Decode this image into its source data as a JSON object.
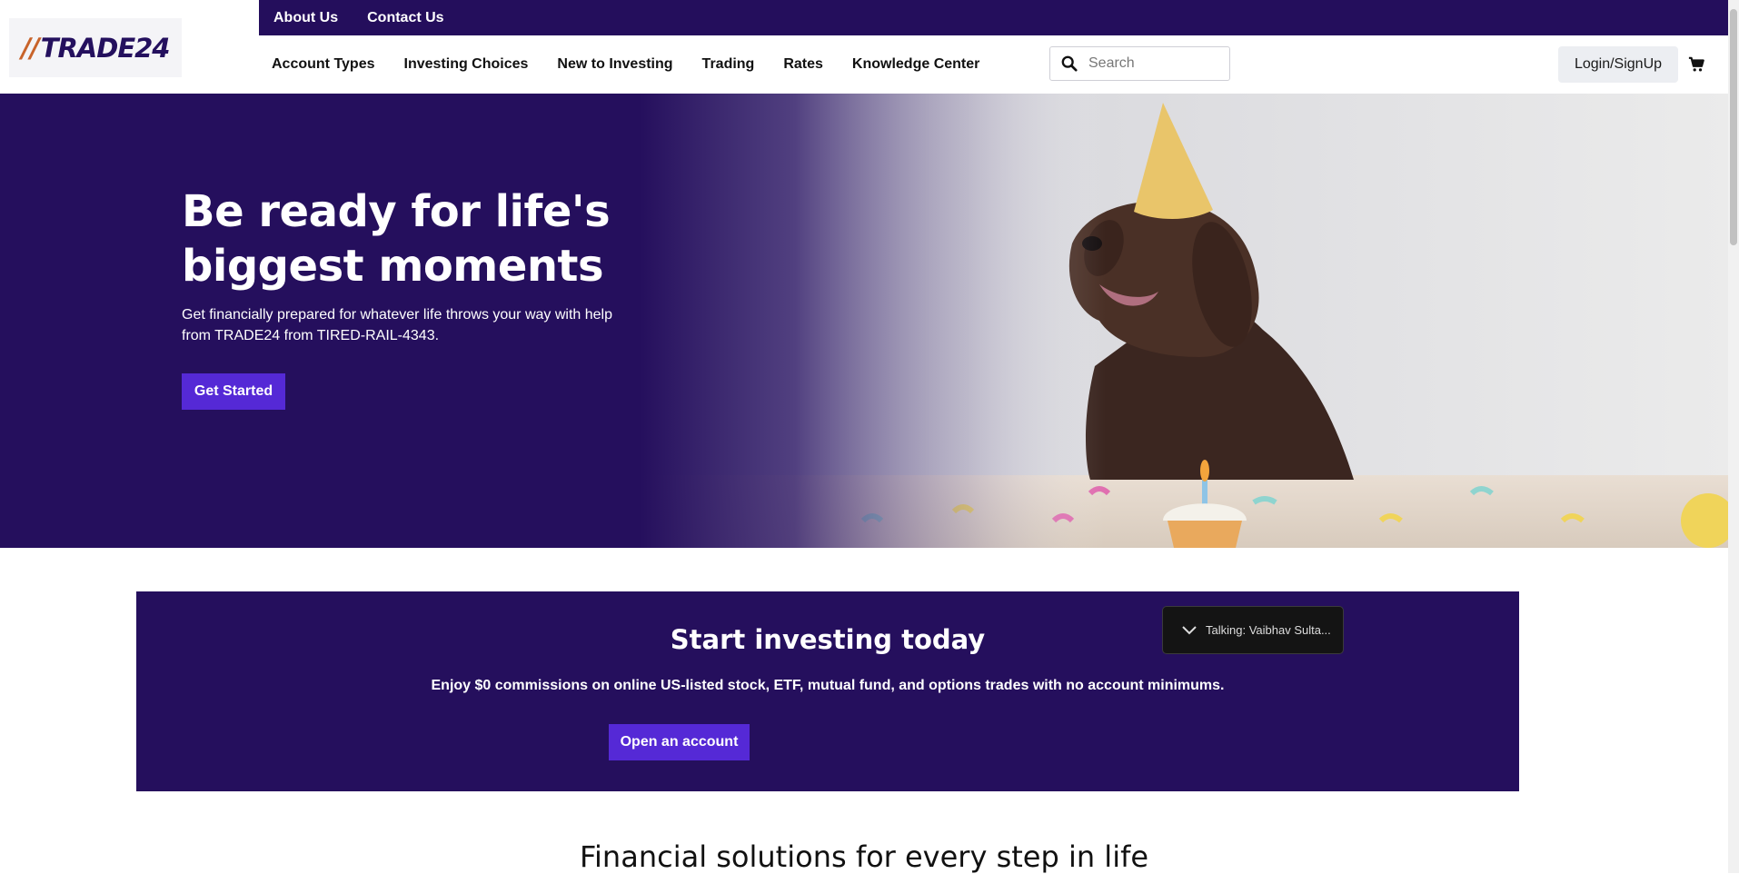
{
  "brand": {
    "logo_slash": "//",
    "logo_word": "TRADE24"
  },
  "topbar": {
    "about": "About Us",
    "contact": "Contact Us"
  },
  "nav": {
    "items": [
      {
        "label": "Account Types"
      },
      {
        "label": "Investing Choices"
      },
      {
        "label": "New to Investing"
      },
      {
        "label": "Trading"
      },
      {
        "label": "Rates"
      },
      {
        "label": "Knowledge Center"
      }
    ]
  },
  "search": {
    "placeholder": "Search",
    "value": ""
  },
  "account": {
    "login_label": "Login/SignUp"
  },
  "hero": {
    "title": "Be ready for life's biggest moments",
    "text": "Get financially prepared for whatever life throws your way with help from TRADE24 from TIRED-RAIL-4343.",
    "cta": "Get Started"
  },
  "invest": {
    "title": "Start investing today",
    "text": "Enjoy $0 commissions on online US-listed stock, ETF, mutual fund, and options trades with no account minimums.",
    "cta": "Open an account"
  },
  "call": {
    "label": "Talking: Vaibhav Sulta..."
  },
  "solutions": {
    "title": "Financial solutions for every step in life"
  },
  "icons": {
    "search": "search-icon",
    "cart": "cart-icon",
    "chevron": "chevron-down-icon"
  },
  "colors": {
    "brand_dark": "#240e5c",
    "brand_button": "#5529d6",
    "logo_accent": "#c8632a"
  }
}
